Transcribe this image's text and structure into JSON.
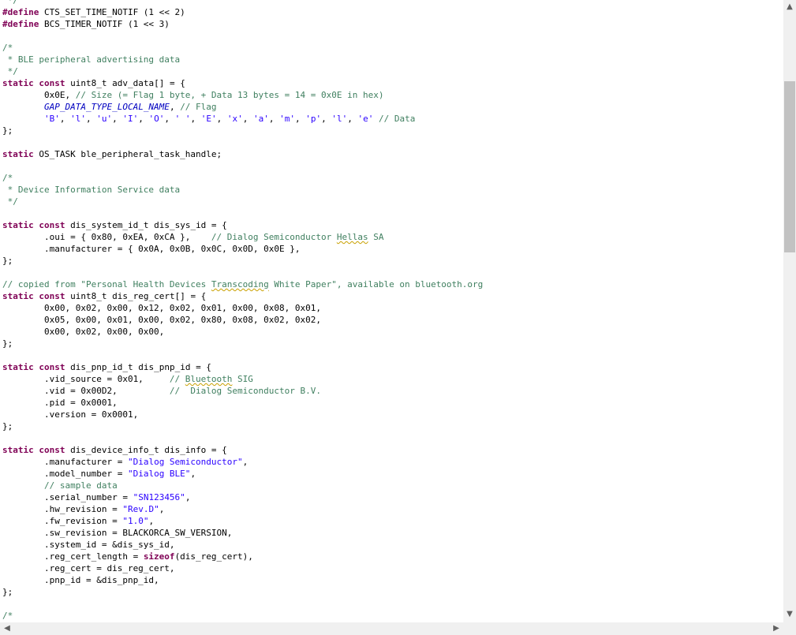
{
  "code": [
    [
      {
        "t": " */",
        "c": "cm"
      }
    ],
    [
      {
        "t": "#define",
        "c": "pp"
      },
      {
        "t": " CTS_SET_TIME_NOTIF (1 << 2)"
      }
    ],
    [
      {
        "t": "#define",
        "c": "pp"
      },
      {
        "t": " BCS_TIMER_NOTIF (1 << 3)"
      }
    ],
    [],
    [
      {
        "t": "/*",
        "c": "cm"
      }
    ],
    [
      {
        "t": " * BLE peripheral advertising data",
        "c": "cm"
      }
    ],
    [
      {
        "t": " */",
        "c": "cm"
      }
    ],
    [
      {
        "t": "static",
        "c": "kw"
      },
      {
        "t": " "
      },
      {
        "t": "const",
        "c": "kw"
      },
      {
        "t": " uint8_t adv_data[] = {"
      }
    ],
    [
      {
        "t": "        0x0E, "
      },
      {
        "t": "// Size (= Flag 1 byte, + Data 13 bytes = 14 = 0x0E in hex)",
        "c": "cm"
      }
    ],
    [
      {
        "t": "        "
      },
      {
        "t": "GAP_DATA_TYPE_LOCAL_NAME",
        "c": "mac"
      },
      {
        "t": ", "
      },
      {
        "t": "// Flag",
        "c": "cm"
      }
    ],
    [
      {
        "t": "        "
      },
      {
        "t": "'B'",
        "c": "st"
      },
      {
        "t": ", "
      },
      {
        "t": "'l'",
        "c": "st"
      },
      {
        "t": ", "
      },
      {
        "t": "'u'",
        "c": "st"
      },
      {
        "t": ", "
      },
      {
        "t": "'I'",
        "c": "st"
      },
      {
        "t": ", "
      },
      {
        "t": "'O'",
        "c": "st"
      },
      {
        "t": ", "
      },
      {
        "t": "' '",
        "c": "st"
      },
      {
        "t": ", "
      },
      {
        "t": "'E'",
        "c": "st"
      },
      {
        "t": ", "
      },
      {
        "t": "'x'",
        "c": "st"
      },
      {
        "t": ", "
      },
      {
        "t": "'a'",
        "c": "st"
      },
      {
        "t": ", "
      },
      {
        "t": "'m'",
        "c": "st"
      },
      {
        "t": ", "
      },
      {
        "t": "'p'",
        "c": "st"
      },
      {
        "t": ", "
      },
      {
        "t": "'l'",
        "c": "st"
      },
      {
        "t": ", "
      },
      {
        "t": "'e'",
        "c": "st"
      },
      {
        "t": " "
      },
      {
        "t": "// Data",
        "c": "cm"
      }
    ],
    [
      {
        "t": "};"
      }
    ],
    [],
    [
      {
        "t": "static",
        "c": "kw"
      },
      {
        "t": " OS_TASK ble_peripheral_task_handle;"
      }
    ],
    [],
    [
      {
        "t": "/*",
        "c": "cm"
      }
    ],
    [
      {
        "t": " * Device Information Service data",
        "c": "cm"
      }
    ],
    [
      {
        "t": " */",
        "c": "cm"
      }
    ],
    [],
    [
      {
        "t": "static",
        "c": "kw"
      },
      {
        "t": " "
      },
      {
        "t": "const",
        "c": "kw"
      },
      {
        "t": " dis_system_id_t dis_sys_id = {"
      }
    ],
    [
      {
        "t": "        .oui = { 0x80, 0xEA, 0xCA },    "
      },
      {
        "t": "// Dialog Semiconductor ",
        "c": "cm"
      },
      {
        "t": "Hellas",
        "c": "cm sp"
      },
      {
        "t": " SA",
        "c": "cm"
      }
    ],
    [
      {
        "t": "        .manufacturer = { 0x0A, 0x0B, 0x0C, 0x0D, 0x0E },"
      }
    ],
    [
      {
        "t": "};"
      }
    ],
    [],
    [
      {
        "t": "// copied from \"Personal Health Devices ",
        "c": "cm"
      },
      {
        "t": "Transcoding",
        "c": "cm sp"
      },
      {
        "t": " White Paper\", available on bluetooth.org",
        "c": "cm"
      }
    ],
    [
      {
        "t": "static",
        "c": "kw"
      },
      {
        "t": " "
      },
      {
        "t": "const",
        "c": "kw"
      },
      {
        "t": " uint8_t dis_reg_cert[] = {"
      }
    ],
    [
      {
        "t": "        0x00, 0x02, 0x00, 0x12, 0x02, 0x01, 0x00, 0x08, 0x01,"
      }
    ],
    [
      {
        "t": "        0x05, 0x00, 0x01, 0x00, 0x02, 0x80, 0x08, 0x02, 0x02,"
      }
    ],
    [
      {
        "t": "        0x00, 0x02, 0x00, 0x00,"
      }
    ],
    [
      {
        "t": "};"
      }
    ],
    [],
    [
      {
        "t": "static",
        "c": "kw"
      },
      {
        "t": " "
      },
      {
        "t": "const",
        "c": "kw"
      },
      {
        "t": " dis_pnp_id_t dis_pnp_id = {"
      }
    ],
    [
      {
        "t": "        .vid_source = 0x01,     "
      },
      {
        "t": "// ",
        "c": "cm"
      },
      {
        "t": "Bluetooth",
        "c": "cm sp"
      },
      {
        "t": " SIG",
        "c": "cm"
      }
    ],
    [
      {
        "t": "        .vid = 0x00D2,          "
      },
      {
        "t": "//  Dialog Semiconductor B.V.",
        "c": "cm"
      }
    ],
    [
      {
        "t": "        .pid = 0x0001,"
      }
    ],
    [
      {
        "t": "        .version = 0x0001,"
      }
    ],
    [
      {
        "t": "};"
      }
    ],
    [],
    [
      {
        "t": "static",
        "c": "kw"
      },
      {
        "t": " "
      },
      {
        "t": "const",
        "c": "kw"
      },
      {
        "t": " dis_device_info_t dis_info = {"
      }
    ],
    [
      {
        "t": "        .manufacturer = "
      },
      {
        "t": "\"Dialog Semiconductor\"",
        "c": "st"
      },
      {
        "t": ","
      }
    ],
    [
      {
        "t": "        .model_number = "
      },
      {
        "t": "\"Dialog BLE\"",
        "c": "st"
      },
      {
        "t": ","
      }
    ],
    [
      {
        "t": "        "
      },
      {
        "t": "// sample data",
        "c": "cm"
      }
    ],
    [
      {
        "t": "        .serial_number = "
      },
      {
        "t": "\"SN123456\"",
        "c": "st"
      },
      {
        "t": ","
      }
    ],
    [
      {
        "t": "        .hw_revision = "
      },
      {
        "t": "\"Rev.D\"",
        "c": "st"
      },
      {
        "t": ","
      }
    ],
    [
      {
        "t": "        .fw_revision = "
      },
      {
        "t": "\"1.0\"",
        "c": "st"
      },
      {
        "t": ","
      }
    ],
    [
      {
        "t": "        .sw_revision = BLACKORCA_SW_VERSION,"
      }
    ],
    [
      {
        "t": "        .system_id = &dis_sys_id,"
      }
    ],
    [
      {
        "t": "        .reg_cert_length = "
      },
      {
        "t": "sizeof",
        "c": "kw"
      },
      {
        "t": "(dis_reg_cert),"
      }
    ],
    [
      {
        "t": "        .reg_cert = dis_reg_cert,"
      }
    ],
    [
      {
        "t": "        .pnp_id = &dis_pnp_id,"
      }
    ],
    [
      {
        "t": "};"
      }
    ],
    [],
    [
      {
        "t": "/*",
        "c": "cm"
      }
    ]
  ],
  "scrollbar": {
    "up_arrow": "▲",
    "down_arrow": "▼",
    "left_arrow": "◀",
    "right_arrow": "▶"
  }
}
